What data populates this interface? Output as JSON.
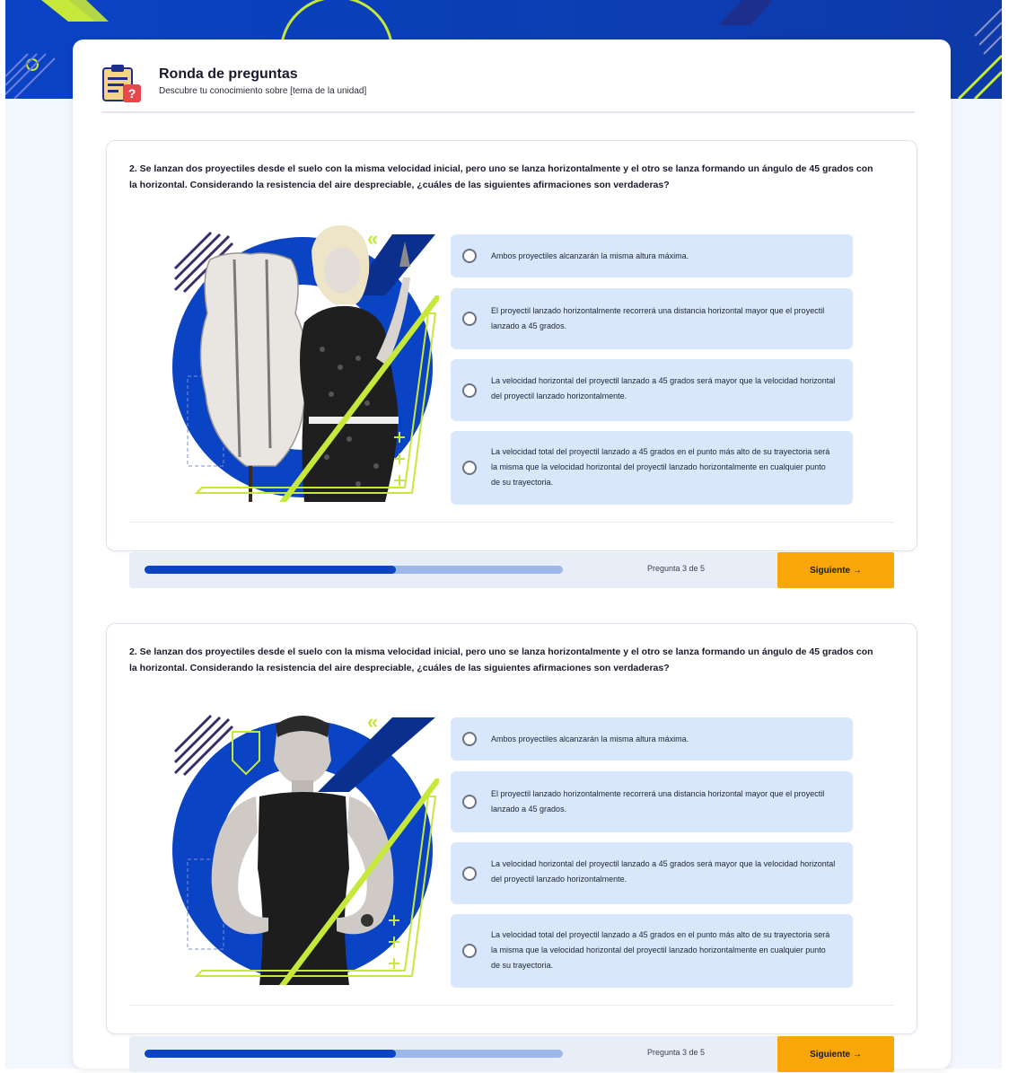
{
  "header": {
    "title": "Ronda de preguntas",
    "subtitle": "Descubre tu conocimiento sobre [tema de la unidad]"
  },
  "questions": [
    {
      "text": "2. Se lanzan dos proyectiles desde el suelo con la misma velocidad inicial, pero uno se lanza horizontalmente y el otro se lanza formando un ángulo de 45 grados con la horizontal. Considerando la resistencia del aire despreciable, ¿cuáles de las siguientes afirmaciones son verdaderas?",
      "image": "illustration-woman-with-mannequin",
      "options": [
        "Ambos proyectiles alcanzarán la misma altura máxima.",
        "El proyectil lanzado horizontalmente recorrerá una distancia horizontal mayor que el proyectil lanzado a 45 grados.",
        "La velocidad horizontal del proyectil lanzado a 45 grados será mayor que la velocidad horizontal del proyectil lanzado horizontalmente.",
        "La velocidad total del proyectil lanzado a 45 grados en el punto más alto de su trayectoria será la misma que la velocidad horizontal del proyectil lanzado horizontalmente en cualquier punto de su trayectoria."
      ],
      "progress_label": "Pregunta 3 de 5",
      "progress_fraction": 0.6,
      "next_label": "Siguiente →"
    },
    {
      "text": "2. Se lanzan dos proyectiles desde el suelo con la misma velocidad inicial, pero uno se lanza horizontalmente y el otro se lanza formando un ángulo de 45 grados con la horizontal. Considerando la resistencia del aire despreciable, ¿cuáles de las siguientes afirmaciones son verdaderas?",
      "image": "illustration-athletic-man",
      "options": [
        "Ambos proyectiles alcanzarán la misma altura máxima.",
        "El proyectil lanzado horizontalmente recorrerá una distancia horizontal mayor que el proyectil lanzado a 45 grados.",
        "La velocidad horizontal del proyectil lanzado a 45 grados será mayor que la velocidad horizontal del proyectil lanzado horizontalmente.",
        "La velocidad total del proyectil lanzado a 45 grados en el punto más alto de su trayectoria será la misma que la velocidad horizontal del proyectil lanzado horizontalmente en cualquier punto de su trayectoria."
      ],
      "progress_label": "Pregunta 3 de 5",
      "progress_fraction": 0.6,
      "next_label": "Siguiente →"
    }
  ],
  "colors": {
    "brand_blue": "#0a43c4",
    "option_bg": "#d8e7fb",
    "accent_lime": "#c6e83a",
    "button_orange": "#f9a60a"
  }
}
